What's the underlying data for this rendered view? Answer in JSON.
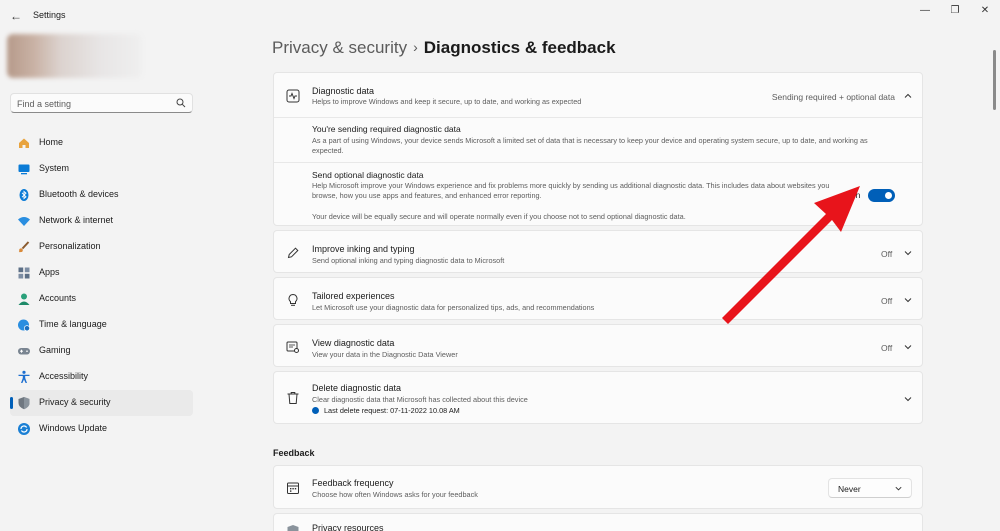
{
  "window": {
    "title": "Settings",
    "back_glyph": "←",
    "minimize_glyph": "—",
    "maximize_glyph": "❐",
    "close_glyph": "✕"
  },
  "sidebar": {
    "search_placeholder": "Find a setting",
    "items": [
      {
        "label": "Home",
        "icon": "home-icon",
        "color": "#e8a33d"
      },
      {
        "label": "System",
        "icon": "system-icon",
        "color": "#0a7bd6"
      },
      {
        "label": "Bluetooth & devices",
        "icon": "bluetooth-icon",
        "color": "#0a7bd6"
      },
      {
        "label": "Network & internet",
        "icon": "wifi-icon",
        "color": "#2a8ee0"
      },
      {
        "label": "Personalization",
        "icon": "brush-icon",
        "color": "#d98a3a"
      },
      {
        "label": "Apps",
        "icon": "apps-icon",
        "color": "#5c6f86"
      },
      {
        "label": "Accounts",
        "icon": "account-icon",
        "color": "#2aa07a"
      },
      {
        "label": "Time & language",
        "icon": "globe-clock-icon",
        "color": "#2a8ee0"
      },
      {
        "label": "Gaming",
        "icon": "gamepad-icon",
        "color": "#7a8591"
      },
      {
        "label": "Accessibility",
        "icon": "accessibility-icon",
        "color": "#1d6fd0"
      },
      {
        "label": "Privacy & security",
        "icon": "shield-icon",
        "color": "#6f7780",
        "selected": true
      },
      {
        "label": "Windows Update",
        "icon": "update-icon",
        "color": "#1a7fd4"
      }
    ]
  },
  "header": {
    "parent": "Privacy & security",
    "separator": "›",
    "current": "Diagnostics & feedback"
  },
  "diagnostic_data": {
    "title": "Diagnostic data",
    "description": "Helps to improve Windows and keep it secure, up to date, and working as expected",
    "status": "Sending required + optional data",
    "required": {
      "title": "You're sending required diagnostic data",
      "text": "As a part of using Windows, your device sends Microsoft a limited set of data that is necessary to keep your device and operating system secure, up to date, and working as expected."
    },
    "optional": {
      "title": "Send optional diagnostic data",
      "text": "Help Microsoft improve your Windows experience and fix problems more quickly by sending us additional diagnostic data. This includes data about websites you browse, how you use apps and features, and enhanced error reporting.",
      "note": "Your device will be equally secure and will operate normally even if you choose not to send optional diagnostic data.",
      "toggle_label": "On",
      "toggle_on": true
    }
  },
  "cards": {
    "inking": {
      "title": "Improve inking and typing",
      "description": "Send optional inking and typing diagnostic data to Microsoft",
      "status": "Off"
    },
    "tailored": {
      "title": "Tailored experiences",
      "description": "Let Microsoft use your diagnostic data for personalized tips, ads, and recommendations",
      "status": "Off"
    },
    "viewer": {
      "title": "View diagnostic data",
      "description": "View your data in the Diagnostic Data Viewer",
      "status": "Off"
    },
    "delete": {
      "title": "Delete diagnostic data",
      "description": "Clear diagnostic data that Microsoft has collected about this device",
      "last_request": "Last delete request: 07-11-2022 10.08 AM"
    }
  },
  "feedback": {
    "section_title": "Feedback",
    "frequency": {
      "title": "Feedback frequency",
      "description": "Choose how often Windows asks for your feedback",
      "value": "Never"
    },
    "privacy_resources": {
      "title": "Privacy resources"
    }
  },
  "colors": {
    "accent": "#005fb8",
    "annotation_arrow": "#e8141b"
  }
}
